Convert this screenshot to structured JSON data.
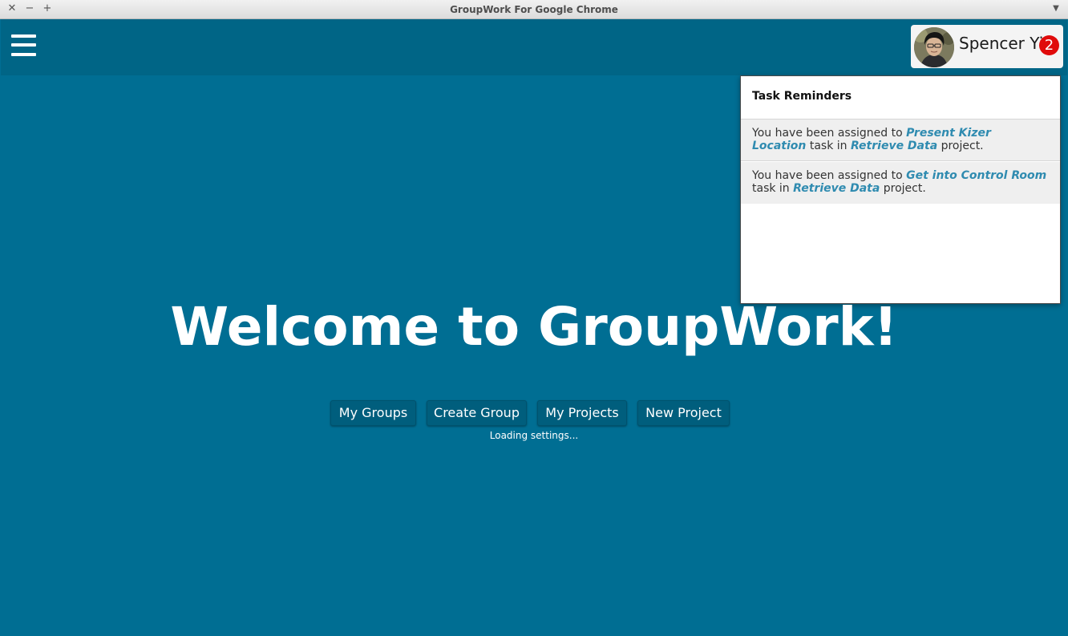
{
  "window": {
    "title": "GroupWork For Google Chrome",
    "close_glyph": "✕",
    "minimize_glyph": "−",
    "maximize_glyph": "+",
    "menu_glyph": "▼"
  },
  "header": {
    "user": {
      "name": "Spencer Yi",
      "notification_count": "2"
    }
  },
  "reminders": {
    "title": "Task Reminders",
    "items": [
      {
        "prefix": "You have been assigned to",
        "task": "Present Kizer Location",
        "middle": "task in",
        "project": "Retrieve Data",
        "suffix": "project."
      },
      {
        "prefix": "You have been assigned to",
        "task": "Get into Control Room",
        "middle": "task in",
        "project": "Retrieve Data",
        "suffix": "project."
      }
    ]
  },
  "main": {
    "welcome": "Welcome to GroupWork!",
    "buttons": {
      "my_groups": "My Groups",
      "create_group": "Create Group",
      "my_projects": "My Projects",
      "new_project": "New Project"
    },
    "status": "Loading settings..."
  },
  "colors": {
    "background": "#006e93",
    "header": "#006586",
    "link": "#2f8bb0",
    "badge": "#e00b0b"
  }
}
